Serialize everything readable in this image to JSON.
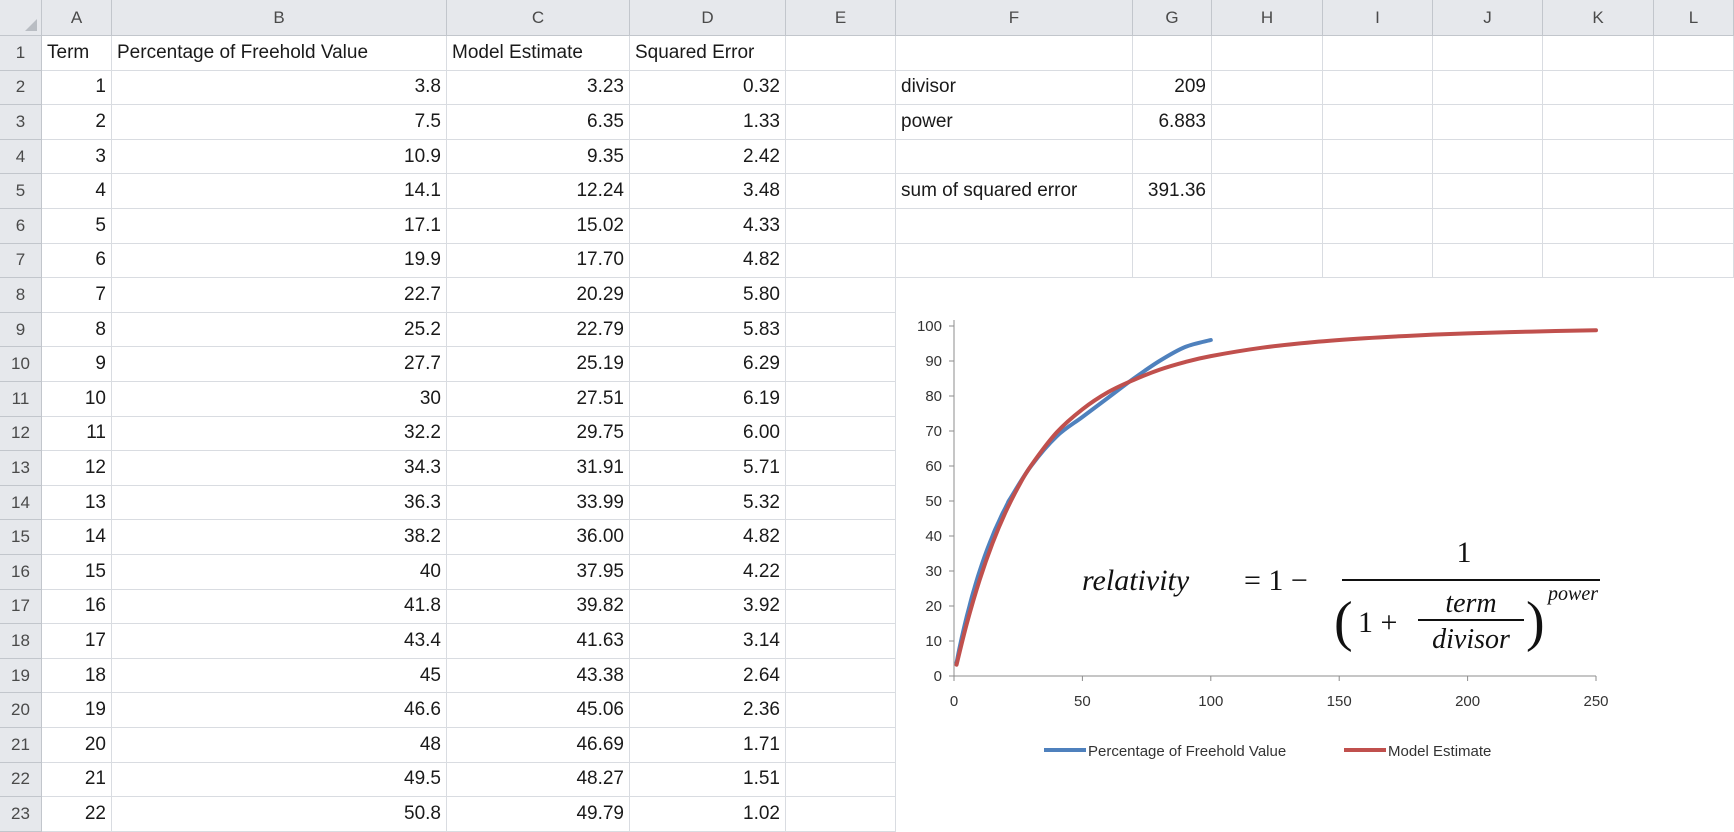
{
  "columns": [
    "A",
    "B",
    "C",
    "D",
    "E",
    "F",
    "G",
    "H",
    "I",
    "J",
    "K",
    "L"
  ],
  "rows": [
    {
      "n": "1",
      "A": "Term",
      "B": "Percentage of Freehold Value",
      "C": "Model Estimate",
      "D": "Squared Error",
      "F": "",
      "G": ""
    },
    {
      "n": "2",
      "A": "1",
      "B": "3.8",
      "C": "3.23",
      "D": "0.32",
      "F": "divisor",
      "G": "209"
    },
    {
      "n": "3",
      "A": "2",
      "B": "7.5",
      "C": "6.35",
      "D": "1.33",
      "F": "power",
      "G": "6.883"
    },
    {
      "n": "4",
      "A": "3",
      "B": "10.9",
      "C": "9.35",
      "D": "2.42",
      "F": "",
      "G": ""
    },
    {
      "n": "5",
      "A": "4",
      "B": "14.1",
      "C": "12.24",
      "D": "3.48",
      "F": "sum of squared error",
      "G": "391.36"
    },
    {
      "n": "6",
      "A": "5",
      "B": "17.1",
      "C": "15.02",
      "D": "4.33",
      "F": "",
      "G": ""
    },
    {
      "n": "7",
      "A": "6",
      "B": "19.9",
      "C": "17.70",
      "D": "4.82",
      "F": "",
      "G": ""
    },
    {
      "n": "8",
      "A": "7",
      "B": "22.7",
      "C": "20.29",
      "D": "5.80",
      "F": "",
      "G": ""
    },
    {
      "n": "9",
      "A": "8",
      "B": "25.2",
      "C": "22.79",
      "D": "5.83",
      "F": "",
      "G": ""
    },
    {
      "n": "10",
      "A": "9",
      "B": "27.7",
      "C": "25.19",
      "D": "6.29",
      "F": "",
      "G": ""
    },
    {
      "n": "11",
      "A": "10",
      "B": "30",
      "C": "27.51",
      "D": "6.19",
      "F": "",
      "G": ""
    },
    {
      "n": "12",
      "A": "11",
      "B": "32.2",
      "C": "29.75",
      "D": "6.00",
      "F": "",
      "G": ""
    },
    {
      "n": "13",
      "A": "12",
      "B": "34.3",
      "C": "31.91",
      "D": "5.71",
      "F": "",
      "G": ""
    },
    {
      "n": "14",
      "A": "13",
      "B": "36.3",
      "C": "33.99",
      "D": "5.32",
      "F": "",
      "G": ""
    },
    {
      "n": "15",
      "A": "14",
      "B": "38.2",
      "C": "36.00",
      "D": "4.82",
      "F": "",
      "G": ""
    },
    {
      "n": "16",
      "A": "15",
      "B": "40",
      "C": "37.95",
      "D": "4.22",
      "F": "",
      "G": ""
    },
    {
      "n": "17",
      "A": "16",
      "B": "41.8",
      "C": "39.82",
      "D": "3.92",
      "F": "",
      "G": ""
    },
    {
      "n": "18",
      "A": "17",
      "B": "43.4",
      "C": "41.63",
      "D": "3.14",
      "F": "",
      "G": ""
    },
    {
      "n": "19",
      "A": "18",
      "B": "45",
      "C": "43.38",
      "D": "2.64",
      "F": "",
      "G": ""
    },
    {
      "n": "20",
      "A": "19",
      "B": "46.6",
      "C": "45.06",
      "D": "2.36",
      "F": "",
      "G": ""
    },
    {
      "n": "21",
      "A": "20",
      "B": "48",
      "C": "46.69",
      "D": "1.71",
      "F": "",
      "G": ""
    },
    {
      "n": "22",
      "A": "21",
      "B": "49.5",
      "C": "48.27",
      "D": "1.51",
      "F": "",
      "G": ""
    },
    {
      "n": "23",
      "A": "22",
      "B": "50.8",
      "C": "49.79",
      "D": "1.02",
      "F": "",
      "G": ""
    }
  ],
  "colors": {
    "header_bg": "#e6e8ec",
    "grid": "#d9dce1",
    "series_blue": "#4f81bd",
    "series_red": "#c0504d"
  },
  "formula": {
    "lhs": "relativity",
    "eq": "= 1 −",
    "num": "1",
    "inner_one": "1 +",
    "term": "term",
    "divisor": "divisor",
    "exponent": "power"
  },
  "chart_data": {
    "type": "line",
    "xlim": [
      0,
      250
    ],
    "ylim": [
      0,
      100
    ],
    "x_ticks": [
      "0",
      "50",
      "100",
      "150",
      "200",
      "250"
    ],
    "y_ticks": [
      "0",
      "10",
      "20",
      "30",
      "40",
      "50",
      "60",
      "70",
      "80",
      "90",
      "100"
    ],
    "grid": false,
    "legend_position": "bottom",
    "series": [
      {
        "name": "Percentage of Freehold Value",
        "color": "#4f81bd",
        "x": [
          1,
          2,
          3,
          4,
          5,
          6,
          7,
          8,
          9,
          10,
          11,
          12,
          13,
          14,
          15,
          16,
          17,
          18,
          19,
          20,
          21,
          22,
          30,
          40,
          50,
          60,
          70,
          80,
          90,
          100
        ],
        "y": [
          3.8,
          7.5,
          10.9,
          14.1,
          17.1,
          19.9,
          22.7,
          25.2,
          27.7,
          30,
          32.2,
          34.3,
          36.3,
          38.2,
          40,
          41.8,
          43.4,
          45,
          46.6,
          48,
          49.5,
          50.8,
          60,
          68.5,
          74,
          79.5,
          85,
          90,
          94,
          96
        ]
      },
      {
        "name": "Model Estimate",
        "color": "#c0504d",
        "x": [
          1,
          5,
          10,
          15,
          20,
          25,
          30,
          40,
          50,
          60,
          70,
          80,
          90,
          100,
          120,
          140,
          160,
          180,
          200,
          225,
          250
        ],
        "y": [
          3.23,
          15.02,
          27.51,
          37.95,
          46.69,
          54.0,
          60.1,
          69.6,
          76.2,
          81.1,
          84.6,
          87.5,
          89.7,
          91.4,
          93.8,
          95.4,
          96.5,
          97.3,
          97.9,
          98.4,
          98.8
        ]
      }
    ]
  }
}
